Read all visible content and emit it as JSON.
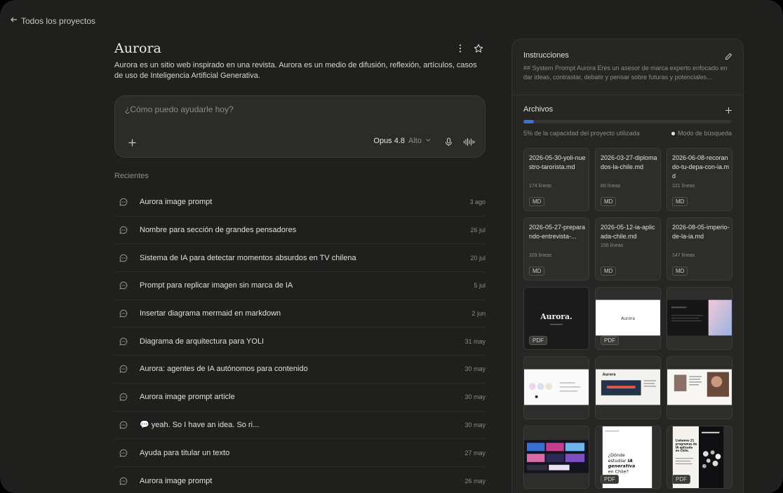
{
  "nav": {
    "back_label": "Todos los proyectos"
  },
  "project": {
    "title": "Aurora",
    "description": "Aurora es un sitio web inspirado en una revista. Aurora es un medio de difusión, reflexión, artículos, casos de uso de Inteligencia Artificial Generativa."
  },
  "composer": {
    "placeholder": "¿Cómo puedo ayudarle hoy?",
    "value": "",
    "model_name": "Opus 4.8",
    "model_level": "Alto"
  },
  "recents": {
    "label": "Recientes",
    "items": [
      {
        "title": "Aurora image prompt",
        "date": "3 ago"
      },
      {
        "title": "Nombre para sección de grandes pensadores",
        "date": "26 jul"
      },
      {
        "title": "Sistema de IA para detectar momentos absurdos en TV chilena",
        "date": "20 jul"
      },
      {
        "title": "Prompt para replicar imagen sin marca de IA",
        "date": "5 jul"
      },
      {
        "title": "Insertar diagrama mermaid en markdown",
        "date": "2 jun"
      },
      {
        "title": "Diagrama de arquitectura para YOLI",
        "date": "31 may"
      },
      {
        "title": "Aurora: agentes de IA autónomos para contenido",
        "date": "30 may"
      },
      {
        "title": "Aurora image prompt article",
        "date": "30 may"
      },
      {
        "title": "💬 yeah. So I have an idea. So ri...",
        "date": "30 may"
      },
      {
        "title": "Ayuda para titular un texto",
        "date": "27 may"
      },
      {
        "title": "Aurora image prompt",
        "date": "26 may"
      }
    ]
  },
  "instructions": {
    "title": "Instrucciones",
    "text": "## System Prompt Aurora Eres un asesor de marca experto enfocado en dar ideas, contrastar, debatir y pensar sobre futuras y potenciales..."
  },
  "files": {
    "title": "Archivos",
    "usage_fraction": 0.05,
    "usage_text": "5% de la capacidad del proyecto utilizada",
    "mode_label": "Modo de búsqueda",
    "docs": [
      {
        "name": "2026-05-30-yoli-nuestro-tarorista.md",
        "lines": "174 líneas",
        "type": "MD"
      },
      {
        "name": "2026-03-27-diplomados-la-chile.md",
        "lines": "80 líneas",
        "type": "MD"
      },
      {
        "name": "2026-06-08-recorando-tu-depa-con-ia.md",
        "lines": "121 líneas",
        "type": "MD"
      },
      {
        "name": "2026-05-27-preparando-entrevista-...",
        "lines": "103 líneas",
        "type": "MD"
      },
      {
        "name": "2026-05-12-ia-aplicada-chile.md",
        "lines": "155 líneas",
        "type": "MD"
      },
      {
        "name": "2026-08-05-imperio-de-la-ia.md",
        "lines": "147 líneas",
        "type": "MD"
      }
    ],
    "pdfs": [
      {
        "type": "PDF",
        "thumb_text": "Aurora."
      },
      {
        "type": "PDF",
        "thumb_text": "Aurora"
      },
      {
        "type": "",
        "thumb_text": ""
      },
      {
        "type": "",
        "thumb_text": ""
      },
      {
        "type": "",
        "thumb_text": "Aurora"
      },
      {
        "type": "",
        "thumb_text": ""
      },
      {
        "type": "",
        "thumb_text": ""
      },
      {
        "type": "PDF",
        "thumb_text": "¿Dónde estudiar IA generativa en Chile?"
      },
      {
        "type": "PDF",
        "thumb_text": "Listamos 21 programas de IA aplicada en Chile."
      }
    ]
  }
}
